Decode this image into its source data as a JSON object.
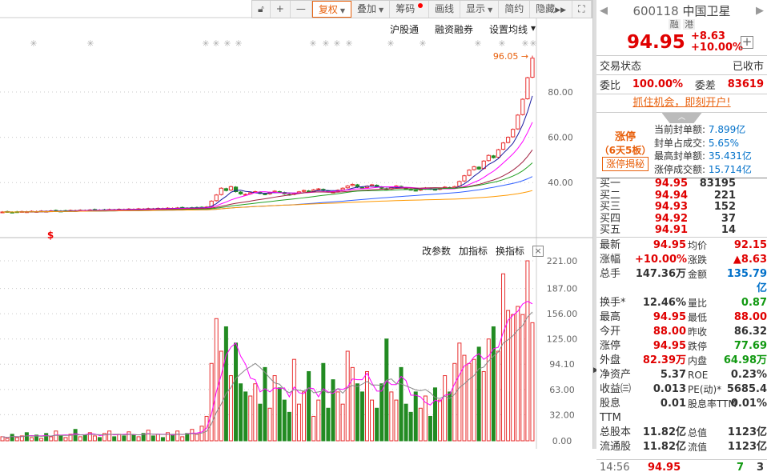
{
  "toolbar": {
    "items": [
      {
        "label": "",
        "icon": "unlock-icon"
      },
      {
        "label": "+"
      },
      {
        "label": "—"
      },
      {
        "label": "复权",
        "active": true,
        "dropdown": true
      },
      {
        "label": "叠加",
        "dropdown": true
      },
      {
        "label": "筹码",
        "dot": true
      },
      {
        "label": "画线"
      },
      {
        "label": "显示",
        "dropdown": true
      },
      {
        "label": "简约"
      },
      {
        "label": "隐藏",
        "more": true
      },
      {
        "label": "",
        "icon": "fullscreen-icon"
      }
    ]
  },
  "upper_links": [
    "沪股通",
    "融资融券",
    "设置均线"
  ],
  "lower_links": [
    "改参数",
    "加指标",
    "换指标"
  ],
  "max_marker": "96.05 →",
  "colors": {
    "up": "#e83030",
    "down": "#228B22",
    "accent": "#e8600c",
    "ma5": "#1a1aa0",
    "ma10": "#ff00ff",
    "ma20": "#a02040",
    "ma30": "#22a022",
    "ma60": "#3060ff",
    "ma120": "#ff9900"
  },
  "chart_data": [
    {
      "type": "candlestick",
      "price_axis": {
        "ticks": [
          40,
          60,
          80
        ],
        "labels": [
          "40.00",
          "60.00",
          "80.00"
        ]
      },
      "close": [
        27.0,
        27.1,
        26.9,
        27.0,
        27.2,
        27.1,
        27.3,
        27.2,
        27.4,
        27.3,
        27.5,
        27.6,
        27.4,
        27.5,
        27.7,
        27.6,
        27.8,
        27.7,
        27.9,
        28.0,
        27.8,
        27.9,
        28.1,
        28.0,
        28.2,
        28.1,
        28.3,
        28.2,
        28.4,
        28.3,
        28.5,
        28.4,
        28.6,
        28.5,
        28.7,
        28.6,
        28.8,
        28.9,
        28.7,
        28.8,
        28.9,
        29.0,
        29.2,
        31.8,
        34.5,
        37.5,
        36.5,
        38.2,
        36.0,
        35.0,
        34.8,
        35.5,
        36.0,
        35.2,
        34.8,
        35.6,
        36.2,
        35.8,
        35.0,
        34.6,
        35.2,
        35.9,
        36.5,
        36.0,
        36.8,
        37.2,
        36.5,
        36.0,
        35.8,
        36.6,
        37.5,
        38.5,
        39.2,
        38.0,
        37.6,
        38.4,
        39.0,
        38.2,
        37.5,
        37.0,
        37.8,
        38.5,
        37.9,
        37.2,
        36.8,
        36.5,
        37.0,
        37.6,
        37.2,
        36.8,
        37.4,
        38.0,
        37.5,
        38.2,
        40.5,
        43.0,
        45.5,
        47.0,
        46.0,
        49.5,
        52.0,
        51.0,
        54.5,
        57.5,
        60.0,
        63.5,
        69.8,
        76.8,
        86.32,
        94.95
      ],
      "last_high": 96.05,
      "moving_averages": [
        5,
        10,
        20,
        30,
        60,
        120
      ]
    },
    {
      "type": "bar",
      "name": "volume",
      "y_axis": {
        "ticks": [
          0,
          32,
          63,
          94.1,
          125,
          156,
          187,
          221
        ],
        "labels": [
          "0.00",
          "32.00",
          "63.00",
          "94.10",
          "125.00",
          "156.00",
          "187.00",
          "221.00"
        ]
      },
      "values": [
        5,
        3,
        8,
        4,
        6,
        10,
        4,
        7,
        3,
        9,
        5,
        12,
        6,
        4,
        8,
        14,
        5,
        7,
        10,
        6,
        4,
        9,
        12,
        5,
        8,
        6,
        11,
        7,
        5,
        9,
        13,
        6,
        8,
        4,
        10,
        7,
        12,
        5,
        9,
        14,
        8,
        18,
        30,
        95,
        150,
        110,
        140,
        80,
        120,
        70,
        60,
        55,
        70,
        45,
        90,
        40,
        80,
        65,
        50,
        35,
        100,
        45,
        60,
        85,
        30,
        50,
        95,
        40,
        75,
        60,
        45,
        110,
        90,
        70,
        60,
        85,
        50,
        40,
        70,
        125,
        60,
        50,
        90,
        45,
        35,
        60,
        40,
        55,
        30,
        65,
        50,
        80,
        60,
        95,
        120,
        105,
        95,
        100,
        115,
        85,
        125,
        140,
        110,
        205,
        160,
        155,
        165,
        155,
        221,
        145
      ],
      "moving_averages": [
        5,
        10
      ]
    }
  ],
  "quote": {
    "code": "600118",
    "name": "中国卫星",
    "tags": [
      "融",
      "港"
    ],
    "price": "94.95",
    "change": "+8.63",
    "pct": "+10.00%",
    "status_label": "交易状态",
    "status": "已收市",
    "wb_label": "委比",
    "wb": "100.00%",
    "wc_label": "委差",
    "wc": "83619",
    "promo": "抓住机会，即刻开户!",
    "limit_title": "涨停",
    "limit_sub": "（6天5板）",
    "limit_button": "涨停揭秘",
    "limit_info": [
      {
        "k": "当前封单额:",
        "v": "7.899亿"
      },
      {
        "k": "封单占成交:",
        "v": "5.65%"
      },
      {
        "k": "最高封单额:",
        "v": "35.431亿"
      },
      {
        "k": "涨停成交额:",
        "v": "15.714亿"
      }
    ],
    "bids": [
      {
        "k": "买一",
        "p": "94.95",
        "q": "83195"
      },
      {
        "k": "买二",
        "p": "94.94",
        "q": "221"
      },
      {
        "k": "买三",
        "p": "94.93",
        "q": "152"
      },
      {
        "k": "买四",
        "p": "94.92",
        "q": "37"
      },
      {
        "k": "买五",
        "p": "94.91",
        "q": "14"
      }
    ],
    "stats": [
      [
        "最新",
        "94.95",
        "red",
        "均价",
        "92.15",
        "red"
      ],
      [
        "涨幅",
        "+10.00%",
        "red",
        "涨跌",
        "▲8.63",
        "red"
      ],
      [
        "总手",
        "147.36万",
        "gray",
        "金额",
        "135.79亿",
        "blue"
      ],
      [
        "换手*",
        "12.46%",
        "gray",
        "量比",
        "0.87",
        "green"
      ],
      [
        "最高",
        "94.95",
        "red",
        "最低",
        "88.00",
        "red"
      ],
      [
        "今开",
        "88.00",
        "red",
        "昨收",
        "86.32",
        "gray"
      ],
      [
        "涨停",
        "94.95",
        "red",
        "跌停",
        "77.69",
        "green"
      ],
      [
        "外盘",
        "82.39万",
        "red",
        "内盘",
        "64.98万",
        "green"
      ],
      [
        "净资产",
        "5.37",
        "gray",
        "ROE",
        "0.23%",
        "gray"
      ],
      [
        "收益㈢",
        "0.013",
        "gray",
        "PE(动)*",
        "5685.4",
        "gray"
      ],
      [
        "股息TTM",
        "0.01",
        "gray",
        "股息率TTM",
        "0.01%",
        "gray"
      ],
      [
        "总股本",
        "11.82亿",
        "gray",
        "总值",
        "1123亿",
        "gray"
      ],
      [
        "流通股",
        "11.82亿",
        "gray",
        "流值",
        "1123亿",
        "gray"
      ]
    ],
    "tick": {
      "time": "14:56",
      "price": "94.95",
      "vol": "7",
      "n": "3"
    }
  }
}
